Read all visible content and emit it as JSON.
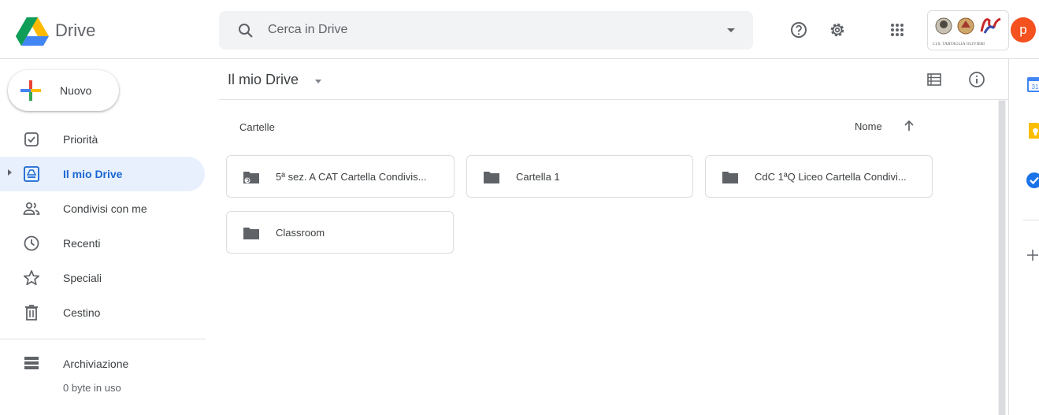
{
  "header": {
    "app_title": "Drive",
    "search_placeholder": "Cerca in Drive",
    "school_logo_text": "I.I.S. TARTAGLIA OLIVIERI",
    "avatar_letter": "p",
    "avatar_color": "#f4511e",
    "icons": [
      "help-icon",
      "settings-icon",
      "apps-grid-icon"
    ]
  },
  "sidebar": {
    "new_button": "Nuovo",
    "items": [
      {
        "label": "Priorità",
        "icon": "priority-check-icon",
        "active": false
      },
      {
        "label": "Il mio Drive",
        "icon": "my-drive-icon",
        "active": true
      },
      {
        "label": "Condivisi con me",
        "icon": "shared-people-icon",
        "active": false
      },
      {
        "label": "Recenti",
        "icon": "clock-icon",
        "active": false
      },
      {
        "label": "Speciali",
        "icon": "star-icon",
        "active": false
      },
      {
        "label": "Cestino",
        "icon": "trash-icon",
        "active": false
      }
    ],
    "storage": {
      "label": "Archiviazione",
      "usage": "0 byte in uso"
    }
  },
  "main": {
    "breadcrumb": "Il mio Drive",
    "section_title": "Cartelle",
    "sort_label": "Nome",
    "folders": [
      {
        "name": "5ª sez. A CAT Cartella Condivis...",
        "shared": true
      },
      {
        "name": "Cartella 1",
        "shared": false
      },
      {
        "name": "CdC 1ªQ Liceo Cartella Condivi...",
        "shared": false
      },
      {
        "name": "Classroom",
        "shared": false
      }
    ]
  },
  "right_panel": {
    "icons": [
      "calendar-icon",
      "keep-icon",
      "tasks-icon",
      "add-addon-icon"
    ],
    "calendar_day": "31"
  },
  "colors": {
    "accent_blue": "#1967d2",
    "active_bg": "#e8f0fe",
    "search_bg": "#f1f3f4"
  }
}
